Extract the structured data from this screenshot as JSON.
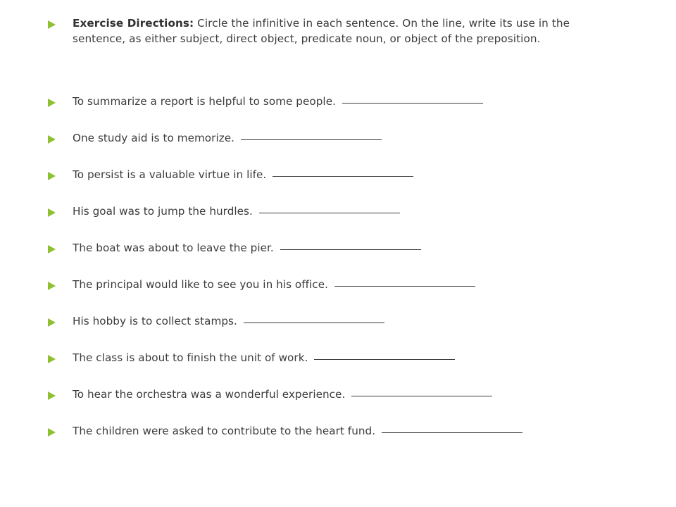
{
  "worksheet": {
    "background_color": "#ffffff",
    "text_color": "#3b3b3b",
    "bullet_color": "#8fc031",
    "blank_line_color": "#3a3a3a",
    "directions": {
      "label": "Exercise Directions:",
      "body": " Circle the infinitive in each sentence.  On the line, write its use in the sentence, as either subject, direct object, predicate noun, or object of the preposition."
    },
    "items": [
      {
        "sentence": "To summarize a report is helpful to some people.",
        "blank_width": 200
      },
      {
        "sentence": "One study aid is to memorize.",
        "blank_width": 200
      },
      {
        "sentence": "To persist is a valuable virtue in life.",
        "blank_width": 200
      },
      {
        "sentence": "His goal was to jump the hurdles.",
        "blank_width": 200
      },
      {
        "sentence": "The boat was about to leave the pier.",
        "blank_width": 200
      },
      {
        "sentence": "The principal would like to see you in his office.",
        "blank_width": 200
      },
      {
        "sentence": "His hobby is to collect stamps.",
        "blank_width": 200
      },
      {
        "sentence": "The class is about to finish the unit of work.",
        "blank_width": 200
      },
      {
        "sentence": "To hear the orchestra was a wonderful experience.",
        "blank_width": 200
      },
      {
        "sentence": "The children were asked to contribute to the heart fund.",
        "blank_width": 200
      }
    ]
  }
}
